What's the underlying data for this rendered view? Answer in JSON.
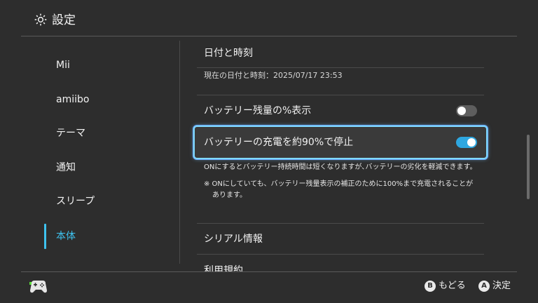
{
  "header": {
    "title": "設定",
    "icon": "gear-icon"
  },
  "sidebar": {
    "items": [
      {
        "label": "Mii"
      },
      {
        "label": "amiibo"
      },
      {
        "label": "テーマ"
      },
      {
        "label": "通知"
      },
      {
        "label": "スリープ"
      },
      {
        "label": "本体",
        "active": true
      }
    ]
  },
  "content": {
    "datetime": {
      "title": "日付と時刻",
      "current": "現在の日付と時刻：2025/07/17 23:53"
    },
    "battery_percent": {
      "title": "バッテリー残量の%表示",
      "enabled": false
    },
    "battery_stop": {
      "title": "バッテリーの充電を約90%で停止",
      "enabled": true
    },
    "battery_note": "ONにするとバッテリー持続時間は短くなりますが､バッテリーの劣化を軽減できます。",
    "battery_note2_line1": "※ ONにしていても、バッテリー残量表示の補正のために100%まで充電されることが",
    "battery_note2_line2": "あります。",
    "serial": {
      "title": "シリアル情報"
    },
    "terms": {
      "title": "利用規約"
    }
  },
  "footer": {
    "back": {
      "button": "B",
      "label": "もどる"
    },
    "confirm": {
      "button": "A",
      "label": "決定"
    }
  },
  "colors": {
    "accent": "#3ec2ef",
    "toggle_on": "#2ea7e0",
    "background": "#2d2d2d"
  }
}
